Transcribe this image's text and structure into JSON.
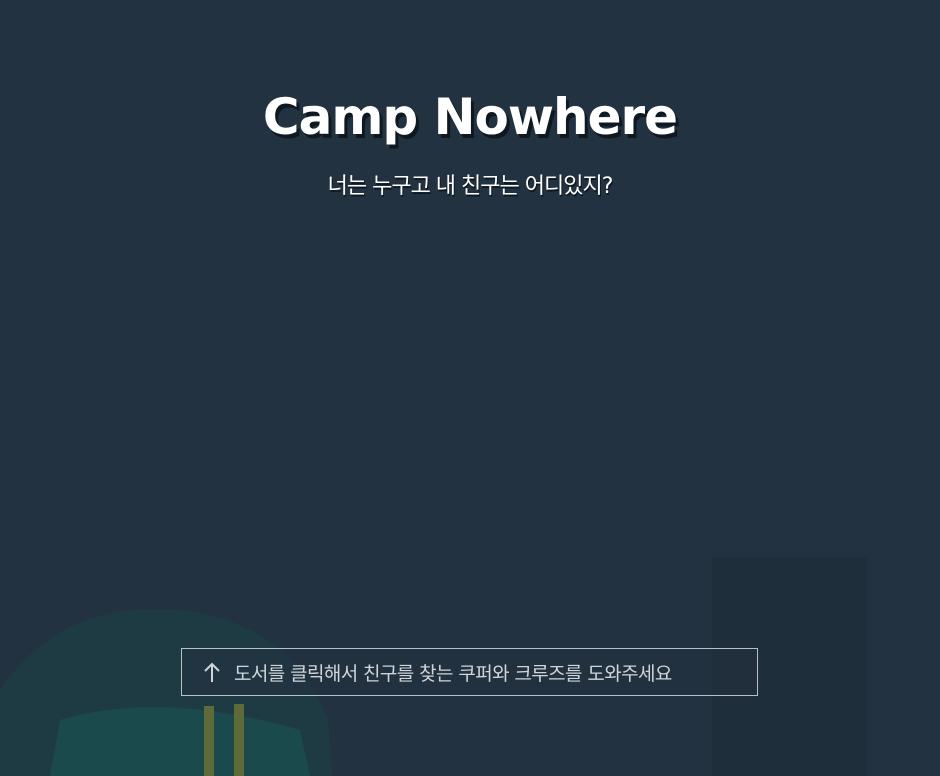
{
  "header": {
    "title": "Camp Nowhere",
    "subtitle": "너는 누구고 내 친구는 어디있지?"
  },
  "hint": {
    "text": "도서를 클릭해서 친구를 찾는 쿠퍼와 크루즈를 도와주세요",
    "icon": "arrow-up-icon"
  },
  "colors": {
    "background": "#223240",
    "text": "#ffffff",
    "hint_text": "#cfd5d9",
    "hint_border": "#b8c0c6"
  }
}
